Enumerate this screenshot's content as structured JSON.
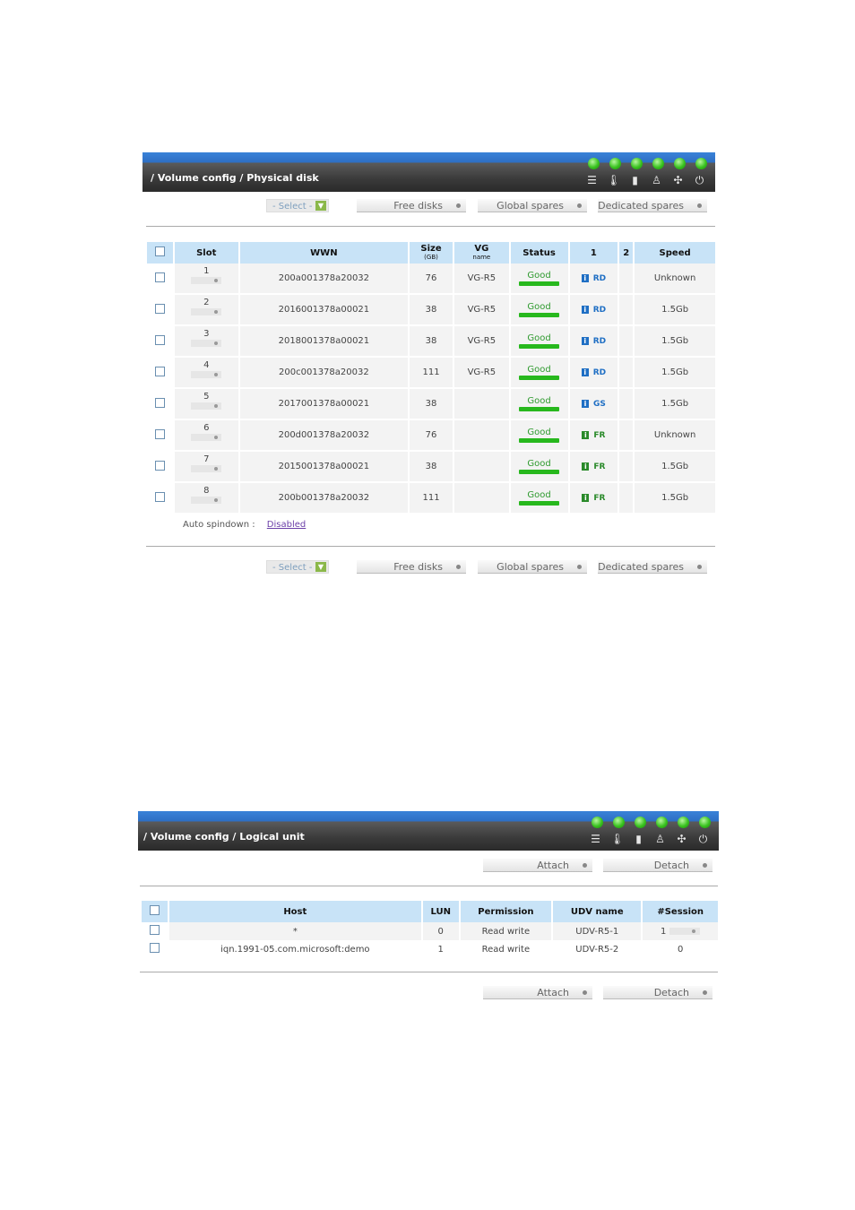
{
  "header_icons": [
    "disk-stack-icon",
    "thermometer-icon",
    "voltage-icon",
    "ups-icon",
    "fan-icon",
    "power-icon"
  ],
  "physical": {
    "title": "/ Volume config / Physical disk",
    "select_label": "- Select -",
    "buttons": {
      "free": "Free disks",
      "global": "Global spares",
      "dedicated": "Dedicated spares"
    },
    "columns": {
      "slot": "Slot",
      "wwn": "WWN",
      "size": "Size",
      "size_unit": "(GB)",
      "vg": "VG",
      "vg_sub": "name",
      "status": "Status",
      "c1": "1",
      "c2": "2",
      "speed": "Speed"
    },
    "rows": [
      {
        "slot": "1",
        "wwn": "200a001378a20032",
        "size": "76",
        "vg": "VG-R5",
        "status": "Good",
        "usage": "RD",
        "speed": "Unknown",
        "usage_color": "#1f6fc4"
      },
      {
        "slot": "2",
        "wwn": "2016001378a00021",
        "size": "38",
        "vg": "VG-R5",
        "status": "Good",
        "usage": "RD",
        "speed": "1.5Gb",
        "usage_color": "#1f6fc4"
      },
      {
        "slot": "3",
        "wwn": "2018001378a00021",
        "size": "38",
        "vg": "VG-R5",
        "status": "Good",
        "usage": "RD",
        "speed": "1.5Gb",
        "usage_color": "#1f6fc4"
      },
      {
        "slot": "4",
        "wwn": "200c001378a20032",
        "size": "111",
        "vg": "VG-R5",
        "status": "Good",
        "usage": "RD",
        "speed": "1.5Gb",
        "usage_color": "#1f6fc4"
      },
      {
        "slot": "5",
        "wwn": "2017001378a00021",
        "size": "38",
        "vg": "",
        "status": "Good",
        "usage": "GS",
        "speed": "1.5Gb",
        "usage_color": "#1f6fc4"
      },
      {
        "slot": "6",
        "wwn": "200d001378a20032",
        "size": "76",
        "vg": "",
        "status": "Good",
        "usage": "FR",
        "speed": "Unknown",
        "usage_color": "#2a8a2a"
      },
      {
        "slot": "7",
        "wwn": "2015001378a00021",
        "size": "38",
        "vg": "",
        "status": "Good",
        "usage": "FR",
        "speed": "1.5Gb",
        "usage_color": "#2a8a2a"
      },
      {
        "slot": "8",
        "wwn": "200b001378a20032",
        "size": "111",
        "vg": "",
        "status": "Good",
        "usage": "FR",
        "speed": "1.5Gb",
        "usage_color": "#2a8a2a"
      }
    ],
    "auto_spindown_label": "Auto spindown :",
    "auto_spindown_value": "Disabled"
  },
  "logical": {
    "title": "/ Volume config / Logical unit",
    "buttons": {
      "attach": "Attach",
      "detach": "Detach"
    },
    "columns": {
      "host": "Host",
      "lun": "LUN",
      "permission": "Permission",
      "udv": "UDV name",
      "session": "#Session"
    },
    "rows": [
      {
        "host": "*",
        "lun": "0",
        "permission": "Read write",
        "udv": "UDV-R5-1",
        "session": "1",
        "has_bar": true
      },
      {
        "host": "iqn.1991-05.com.microsoft:demo",
        "lun": "1",
        "permission": "Read write",
        "udv": "UDV-R5-2",
        "session": "0",
        "has_bar": false
      }
    ]
  }
}
